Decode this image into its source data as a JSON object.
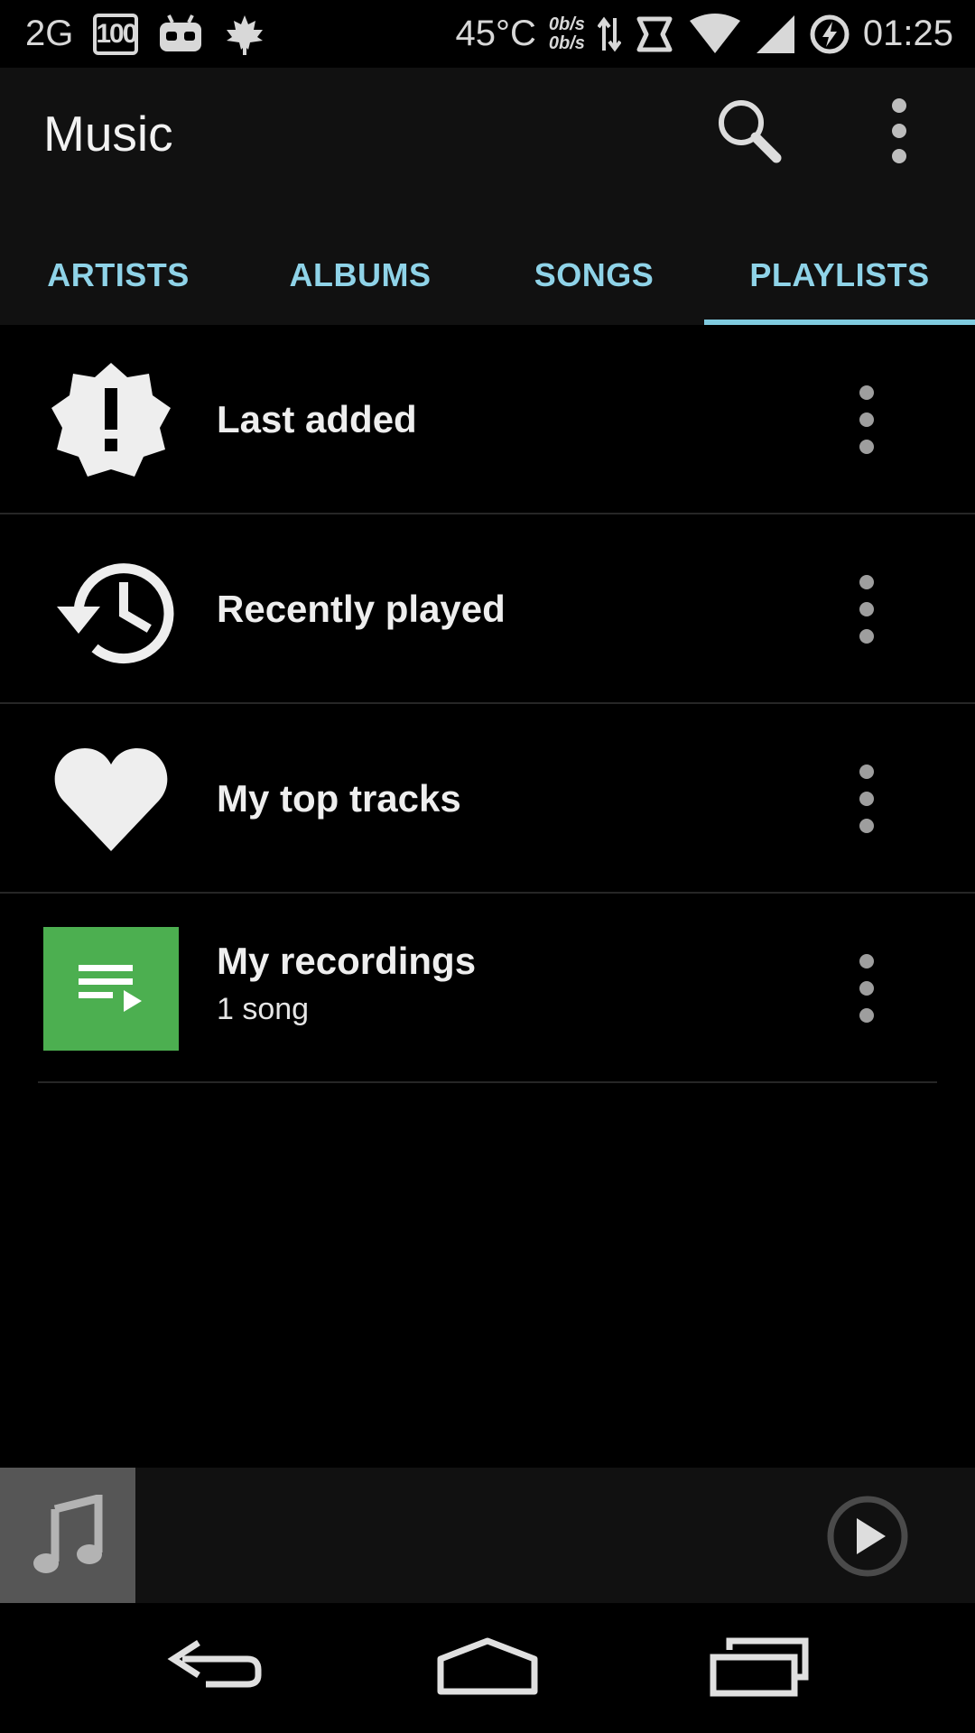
{
  "status_bar": {
    "network": "2G",
    "battery_box": "100",
    "temperature": "45°C",
    "speed_up": "0b/s",
    "speed_down": "0b/s",
    "time": "01:25",
    "icons": [
      "android-debug-icon",
      "leaf-icon",
      "data-arrows-icon",
      "sync-icon",
      "wifi-icon",
      "signal-icon",
      "battery-charging-icon"
    ]
  },
  "app_bar": {
    "title": "Music",
    "actions": [
      "search-icon",
      "overflow-menu-icon"
    ]
  },
  "tabs": [
    {
      "label": "ARTISTS",
      "selected": false
    },
    {
      "label": "ALBUMS",
      "selected": false
    },
    {
      "label": "SONGS",
      "selected": false
    },
    {
      "label": "PLAYLISTS",
      "selected": true
    }
  ],
  "playlists": [
    {
      "title": "Last added",
      "icon": "new-badge-icon"
    },
    {
      "title": "Recently played",
      "icon": "history-icon"
    },
    {
      "title": "My top tracks",
      "icon": "heart-icon"
    },
    {
      "title": "My recordings",
      "subtitle": "1 song",
      "icon": "playlist-play-icon"
    }
  ],
  "now_playing": {
    "icons": [
      "music-note-icon",
      "play-icon"
    ]
  },
  "nav_bar": {
    "icons": [
      "back-icon",
      "home-icon",
      "recents-icon"
    ]
  },
  "colors": {
    "accent": "#80cbe0",
    "tab_text": "#8fd3e8",
    "app_bar_bg": "#111111",
    "list_bg": "#000000",
    "recordings_tile": "#4caf50",
    "album_art_bg": "#565656"
  }
}
